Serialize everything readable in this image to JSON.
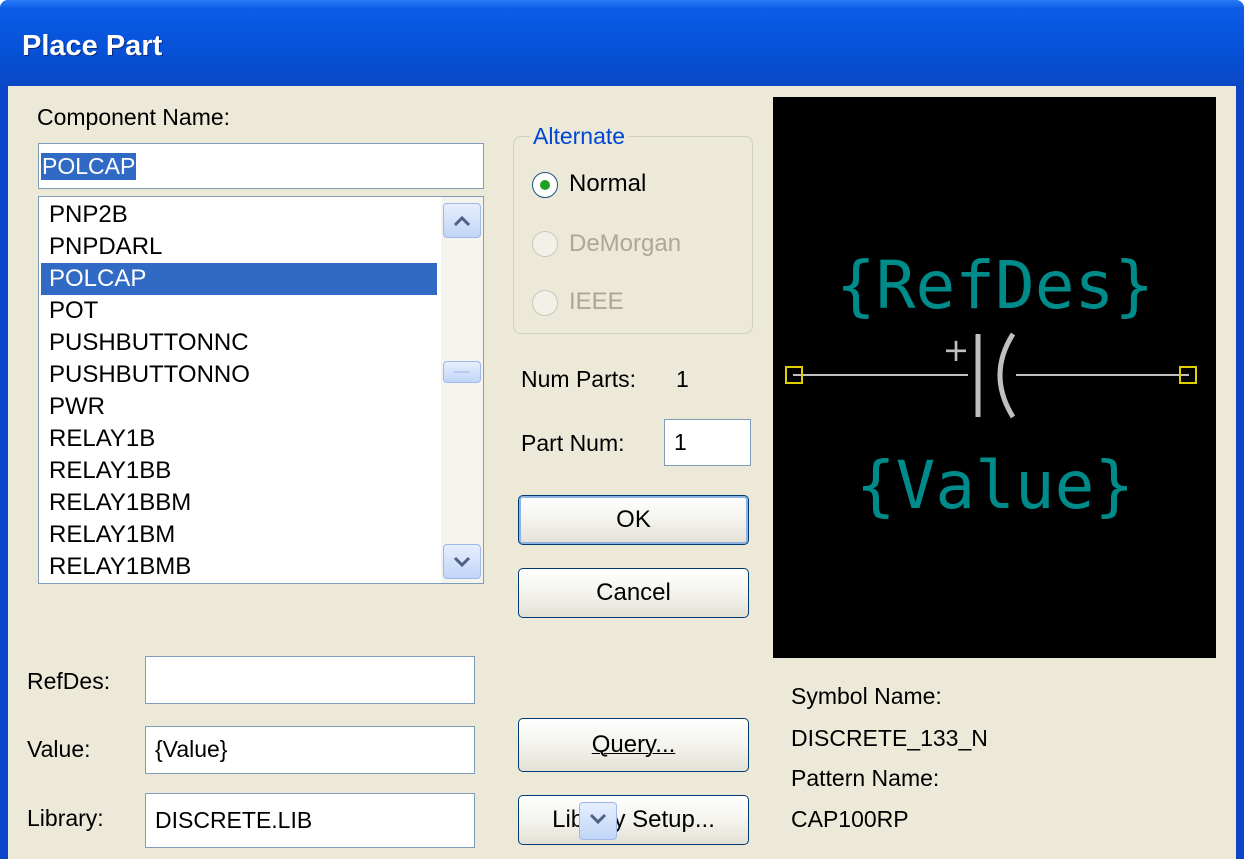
{
  "window": {
    "title": "Place Part"
  },
  "component": {
    "label": "Component Name:",
    "value": "POLCAP",
    "items": [
      "PNP2B",
      "PNPDARL",
      "POLCAP",
      "POT",
      "PUSHBUTTONNC",
      "PUSHBUTTONNO",
      "PWR",
      "RELAY1B",
      "RELAY1BB",
      "RELAY1BBM",
      "RELAY1BM",
      "RELAY1BMB"
    ],
    "selected": "POLCAP"
  },
  "alternate": {
    "title": "Alternate",
    "options": [
      {
        "label": "Normal",
        "checked": true,
        "enabled": true
      },
      {
        "label": "DeMorgan",
        "checked": false,
        "enabled": false
      },
      {
        "label": "IEEE",
        "checked": false,
        "enabled": false
      }
    ]
  },
  "parts": {
    "num_parts_label": "Num Parts:",
    "num_parts_value": "1",
    "part_num_label": "Part Num:",
    "part_num_value": "1"
  },
  "buttons": {
    "ok": "OK",
    "cancel": "Cancel",
    "query": "Query...",
    "library_setup": "Library Setup..."
  },
  "fields": {
    "refdes_label": "RefDes:",
    "refdes_value": "",
    "value_label": "Value:",
    "value_value": "{Value}",
    "library_label": "Library:",
    "library_value": "DISCRETE.LIB"
  },
  "preview": {
    "refdes_text": "{RefDes}",
    "value_text": "{Value}",
    "plus_sign": "+",
    "text_color": "#008b8b",
    "pin_color": "#e0d000",
    "body_color": "#c0c0c0"
  },
  "symbol_info": {
    "symbol_label": "Symbol Name:",
    "symbol_value": "DISCRETE_133_N",
    "pattern_label": "Pattern Name:",
    "pattern_value": "CAP100RP"
  },
  "icons": {
    "scroll_up": "chevron-up-icon",
    "scroll_down": "chevron-down-icon",
    "dropdown": "chevron-down-icon"
  }
}
